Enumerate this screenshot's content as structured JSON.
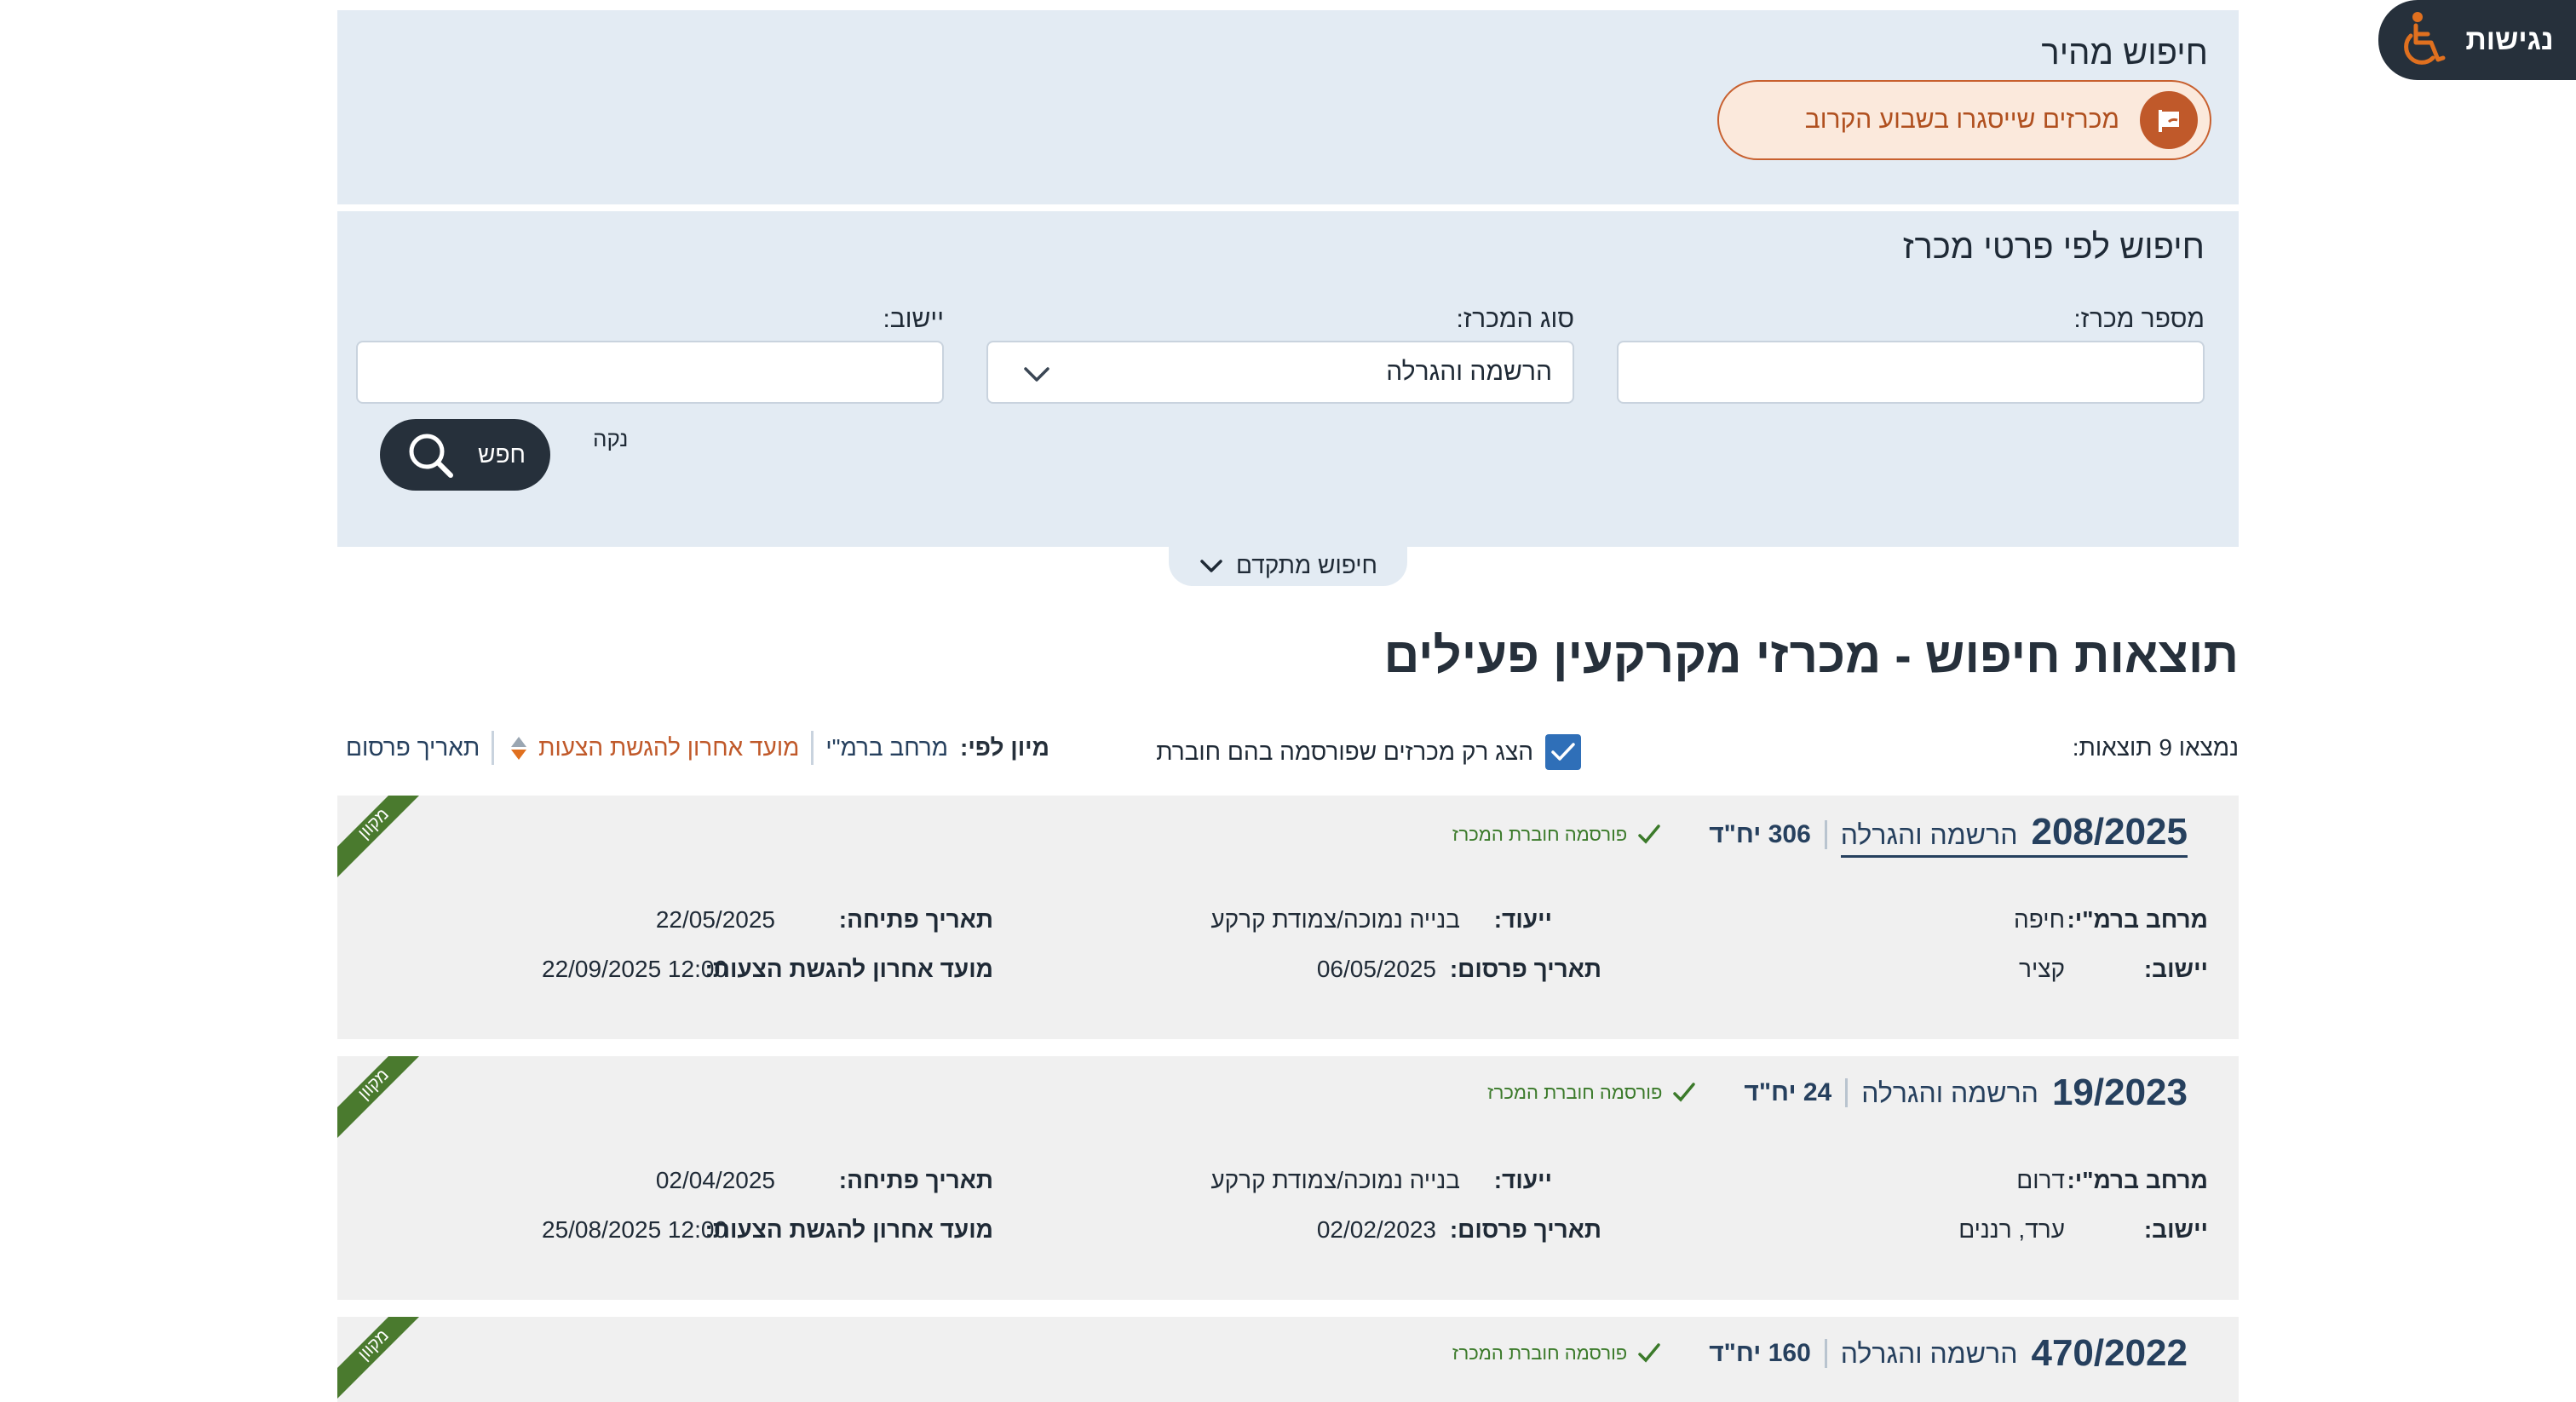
{
  "accessibility": {
    "label": "נגישות",
    "icon": "wheelchair-icon"
  },
  "quick_search": {
    "title": "חיפוש מהיר",
    "pill_label": "מכרזים שייסגרו בשבוע הקרוב",
    "pill_icon": "megaphone-icon"
  },
  "detail_search": {
    "title": "חיפוש לפי פרטי מכרז",
    "fields": {
      "tender_number": {
        "label": "מספר מכרז:",
        "value": "",
        "placeholder": ""
      },
      "tender_type": {
        "label": "סוג המכרז:",
        "value": "הרשמה והגרלה"
      },
      "settlement": {
        "label": "יישוב:",
        "value": "",
        "placeholder": ""
      }
    },
    "clear_label": "נקה",
    "search_label": "חפש",
    "advanced_label": "חיפוש מתקדם"
  },
  "results": {
    "title": "תוצאות חיפוש - מכרזי מקרקעין פעילים",
    "found_text": "נמצאו 9 תוצאות:",
    "filter_label": "הצג רק מכרזים שפורסמה בהם חוברת",
    "filter_checked": true,
    "sort": {
      "label": "מיון לפי:",
      "options": [
        "מרחב ברמ\"י",
        "מועד אחרון להגשת הצעות",
        "תאריך פרסום"
      ],
      "active_index": 1
    },
    "labels": {
      "region": "מרחב ברמ\"י:",
      "settlement": "יישוב:",
      "purpose": "ייעוד:",
      "publish_date": "תאריך פרסום:",
      "open_date": "תאריך פתיחה:",
      "deadline": "מועד אחרון להגשת הצעות:",
      "published_booklet": "פורסמה חוברת המכרז",
      "ribbon": "מקוון"
    },
    "cards": [
      {
        "number": "208/2025",
        "type": "הרשמה והגרלה",
        "units": "306 יח\"ד",
        "region": "חיפה",
        "settlement": "קציר",
        "purpose": "בנייה נמוכה/צמודת קרקע",
        "publish_date": "06/05/2025",
        "open_date": "22/05/2025",
        "deadline": "12:00 22/09/2025"
      },
      {
        "number": "19/2023",
        "type": "הרשמה והגרלה",
        "units": "24 יח\"ד",
        "region": "דרום",
        "settlement": "ערד, רננים",
        "purpose": "בנייה נמוכה/צמודת קרקע",
        "publish_date": "02/02/2023",
        "open_date": "02/04/2025",
        "deadline": "12:00 25/08/2025"
      },
      {
        "number": "470/2022",
        "type": "הרשמה והגרלה",
        "units": "160 יח\"ד"
      }
    ]
  },
  "colors": {
    "panel_bg": "#e3ebf3",
    "dark": "#26303b",
    "accent_orange": "#c0592a",
    "link_blue": "#26405e",
    "ribbon_green": "#4a7a2e",
    "card_bg": "#f0f0f0"
  }
}
